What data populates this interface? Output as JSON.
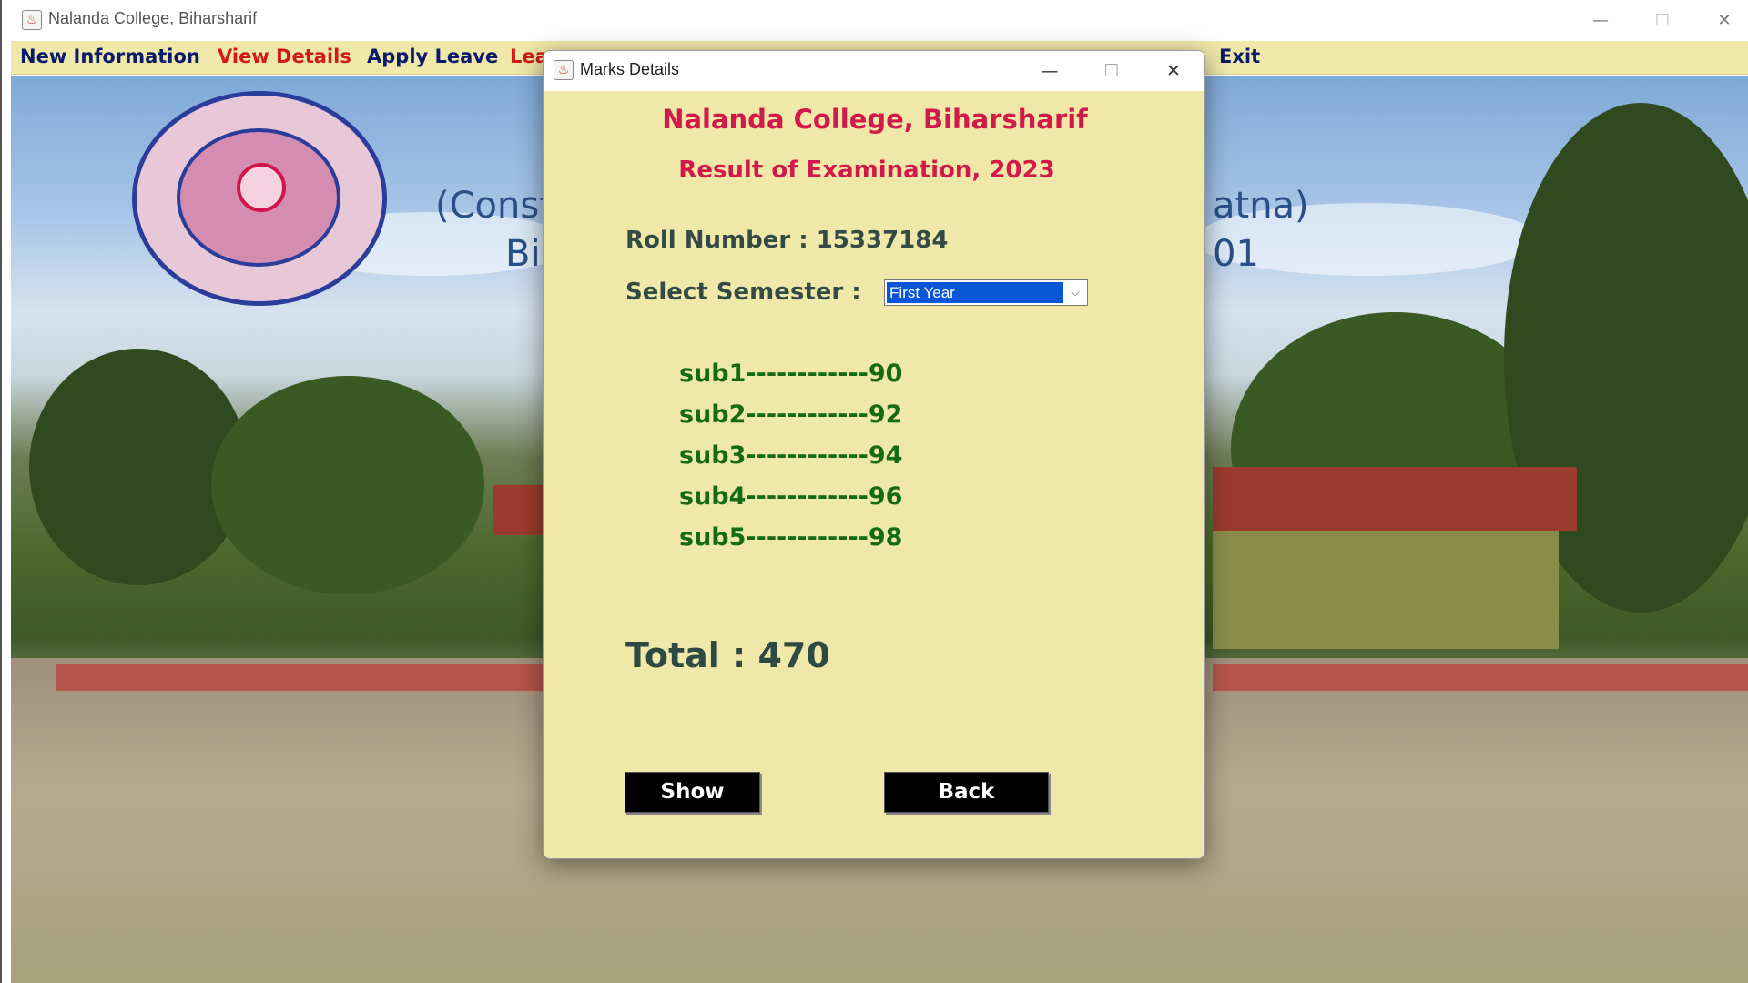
{
  "main_window": {
    "title": "Nalanda College, Biharsharif",
    "controls": {
      "minimize": "—",
      "maximize": "☐",
      "close": "✕"
    }
  },
  "menubar": {
    "items": [
      {
        "label": "New Information",
        "color": "#0b1a6b"
      },
      {
        "label": "View Details",
        "color": "#d11a1a"
      },
      {
        "label": "Apply Leave",
        "color": "#0b1a6b"
      },
      {
        "label": "Lea",
        "color": "#d11a1a"
      },
      {
        "label": "Exit",
        "color": "#0b1a6b"
      }
    ]
  },
  "background": {
    "text_line1_left": "(Const",
    "text_line1_right": "atna)",
    "text_line2_left": "Bi",
    "text_line2_right": "01"
  },
  "dialog": {
    "title": "Marks Details",
    "controls": {
      "minimize": "—",
      "maximize": "☐",
      "close": "✕"
    },
    "college_name": "Nalanda College, Biharsharif",
    "exam_title": "Result of Examination, 2023",
    "roll_label": "Roll Number : ",
    "roll_value": "15337184",
    "semester_label": "Select Semester :",
    "semester_selected": "First Year",
    "marks": [
      {
        "text": "sub1------------90"
      },
      {
        "text": "sub2------------92"
      },
      {
        "text": "sub3------------94"
      },
      {
        "text": "sub4------------96"
      },
      {
        "text": "sub5------------98"
      }
    ],
    "total_label": "Total : ",
    "total_value": "470",
    "buttons": {
      "show": "Show",
      "back": "Back"
    }
  },
  "colors": {
    "dialog_bg": "#efe8a8",
    "heading_red": "#d11a4a",
    "marks_green": "#146b14",
    "selection_blue": "#0a55d6"
  }
}
